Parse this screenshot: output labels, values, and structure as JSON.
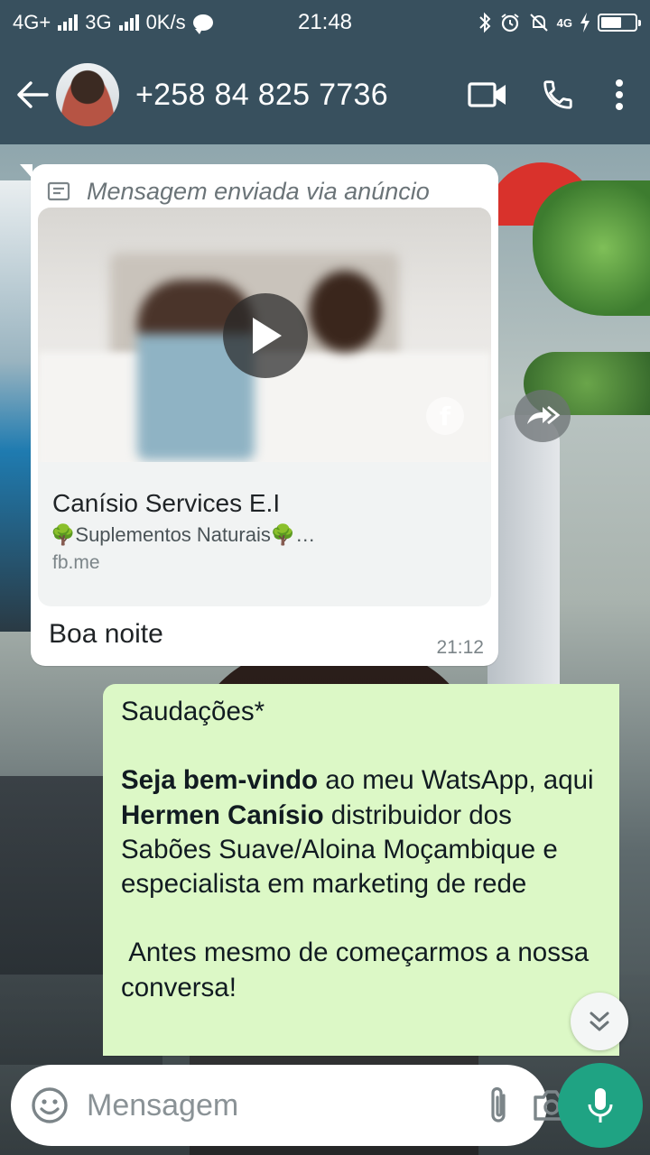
{
  "status_bar": {
    "network1": "4G+",
    "network2": "3G",
    "speed": "0K/s",
    "time": "21:48",
    "network3": "4G"
  },
  "header": {
    "contact": "+258 84 825 7736"
  },
  "incoming": {
    "ad_label": "Mensagem enviada via anúncio",
    "ad_title": "Canísio Services E.I",
    "ad_description": "🌳Suplementos Naturais🌳…",
    "ad_link": "fb.me",
    "text": "Boa noite",
    "time": "21:12"
  },
  "outgoing": {
    "line1": "Saudações*",
    "p2_bold1": "Seja bem-vindo",
    "p2_text1": " ao meu WatsApp, aqui ",
    "p2_bold2": "Hermen Canísio",
    "p2_text2": " distribuidor dos Sabões Suave/Aloina Moçambique e especialista em marketing de rede",
    "p3": " Antes mesmo de começarmos a nossa conversa!"
  },
  "composer": {
    "placeholder": "Mensagem"
  },
  "colors": {
    "header": "#38505e",
    "outgoing_bubble": "#dcf8c6",
    "mic_button": "#1fa383"
  }
}
